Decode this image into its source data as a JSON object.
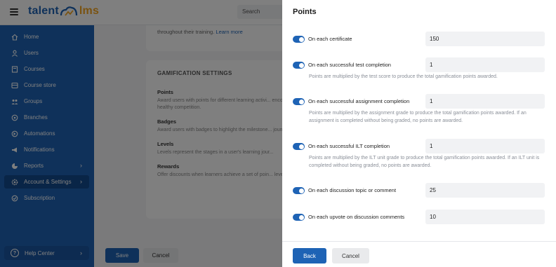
{
  "app": {
    "logo_text_1": "talent",
    "logo_text_2": "lms",
    "search_placeholder": "Search"
  },
  "sidebar": {
    "items": [
      {
        "label": "Home",
        "icon": "home-icon"
      },
      {
        "label": "Users",
        "icon": "user-icon"
      },
      {
        "label": "Courses",
        "icon": "book-icon"
      },
      {
        "label": "Course store",
        "icon": "store-icon"
      },
      {
        "label": "Groups",
        "icon": "group-icon"
      },
      {
        "label": "Branches",
        "icon": "branches-icon"
      },
      {
        "label": "Automations",
        "icon": "automation-icon"
      },
      {
        "label": "Notifications",
        "icon": "megaphone-icon"
      },
      {
        "label": "Reports",
        "icon": "pie-chart-icon",
        "chevron": true
      },
      {
        "label": "Account & Settings",
        "icon": "gear-icon",
        "chevron": true,
        "active": true
      },
      {
        "label": "Subscription",
        "icon": "subscription-icon"
      }
    ],
    "help_label": "Help Center"
  },
  "background": {
    "card1_text": "throughout their training.",
    "card1_link": "Learn more",
    "section_title": "GAMIFICATION SETTINGS",
    "items": [
      {
        "title": "Points",
        "desc": "Award users with points for different learning activi... encourage healthy competition."
      },
      {
        "title": "Badges",
        "desc": "Award users with badges to highlight the milestone... journey."
      },
      {
        "title": "Levels",
        "desc": "Levels represent the stages in a user's learning jour..."
      },
      {
        "title": "Rewards",
        "desc": "Offer discounts when learners achieve a set of poin... levels."
      }
    ],
    "save_label": "Save",
    "cancel_label": "Cancel"
  },
  "drawer": {
    "title": "Points",
    "rows": [
      {
        "label": "On each certificate",
        "value": "150",
        "help": ""
      },
      {
        "label": "On each successful test completion",
        "value": "1",
        "help": "Points are multiplied by the test score to produce the total gamification points awarded."
      },
      {
        "label": "On each successful assignment completion",
        "value": "1",
        "help": "Points are multiplied by the assignment grade to produce the total gamification points awarded. If an assignment is completed without being graded, no points are awarded."
      },
      {
        "label": "On each successful ILT completion",
        "value": "1",
        "help": "Points are multiplied by the ILT unit grade to produce the total gamification points awarded. If an ILT unit is completed without being graded, no points are awarded."
      },
      {
        "label": "On each discussion topic or comment",
        "value": "25",
        "help": ""
      },
      {
        "label": "On each upvote on discussion comments",
        "value": "10",
        "help": ""
      }
    ],
    "back_label": "Back",
    "cancel_label": "Cancel"
  },
  "colors": {
    "brand_blue": "#1e63b5",
    "brand_orange": "#f5a623",
    "active_nav": "#134a8e"
  }
}
